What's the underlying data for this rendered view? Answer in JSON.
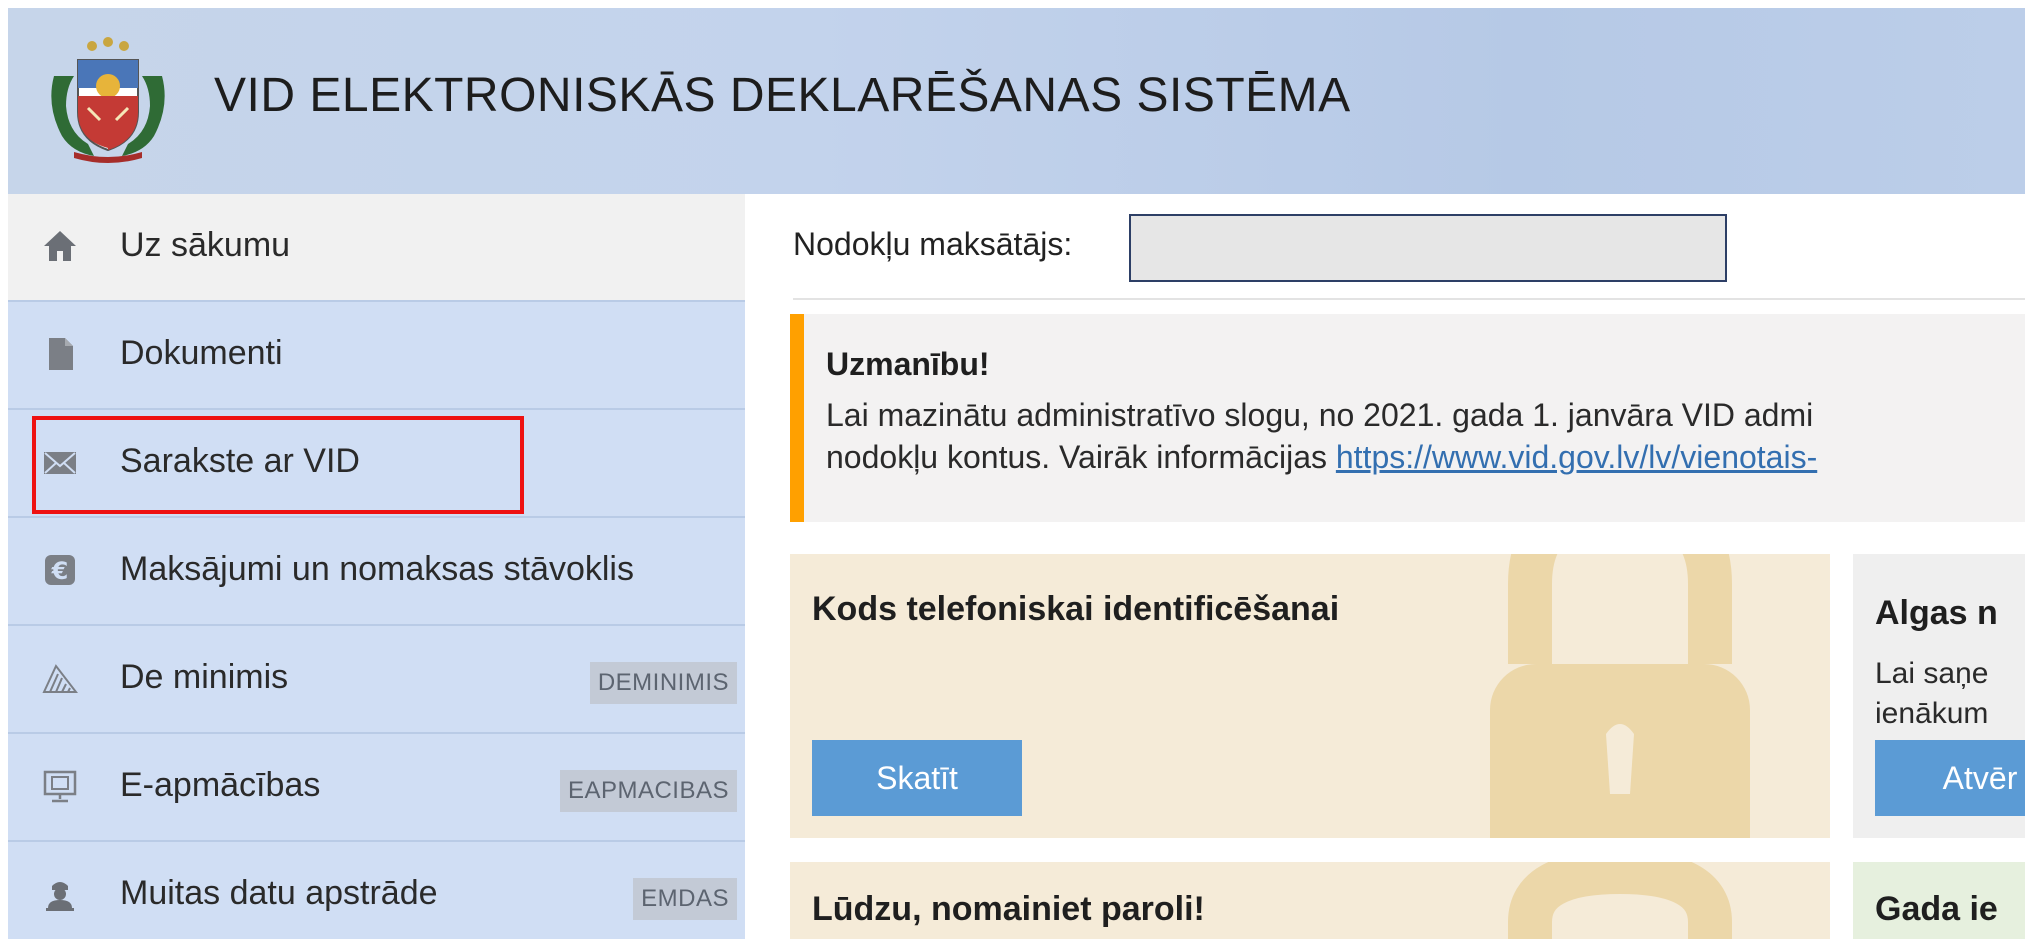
{
  "header": {
    "title": "VID ELEKTRONISKĀS DEKLARĒŠANAS SISTĒMA",
    "logo_icon": "latvia-coat-of-arms-icon"
  },
  "sidebar": {
    "items": [
      {
        "label": "Uz sākumu",
        "icon": "home-icon"
      },
      {
        "label": "Dokumenti",
        "icon": "document-icon"
      },
      {
        "label": "Sarakste ar VID",
        "icon": "envelope-icon"
      },
      {
        "label": "Maksājumi un nomaksas stāvoklis",
        "icon": "euro-icon"
      },
      {
        "label": "De minimis",
        "icon": "triangle-stack-icon",
        "badge": "DEMINIMIS"
      },
      {
        "label": "E-apmācības",
        "icon": "monitor-icon",
        "badge": "EAPMACIBAS"
      },
      {
        "label": "Muitas datu apstrāde",
        "icon": "customs-officer-icon",
        "badge": "EMDAS"
      }
    ]
  },
  "main": {
    "taxpayer_label": "Nodokļu maksātājs:",
    "taxpayer_value": "",
    "alert": {
      "title": "Uzmanību!",
      "line1": "Lai mazinātu administratīvo slogu, no 2021. gada 1. janvāra VID admi",
      "line2_prefix": "nodokļu kontus. Vairāk informācijas ",
      "link": "https://www.vid.gov.lv/lv/vienotais-"
    },
    "cards": {
      "phone_code": {
        "title": "Kods telefoniskai identificēšanai",
        "button": "Skatīt"
      },
      "salary": {
        "title": "Algas n",
        "line1": "Lai saņe",
        "line2": "ienākum",
        "button": "Atvēr"
      },
      "password": {
        "title": "Lūdzu, nomainiet paroli!"
      },
      "annual": {
        "title": "Gada ie"
      }
    }
  },
  "colors": {
    "accent_orange": "#ffa000",
    "button_blue": "#5b9bd5",
    "highlight_red": "#ee1111",
    "sidebar_bg": "#d0def4"
  }
}
